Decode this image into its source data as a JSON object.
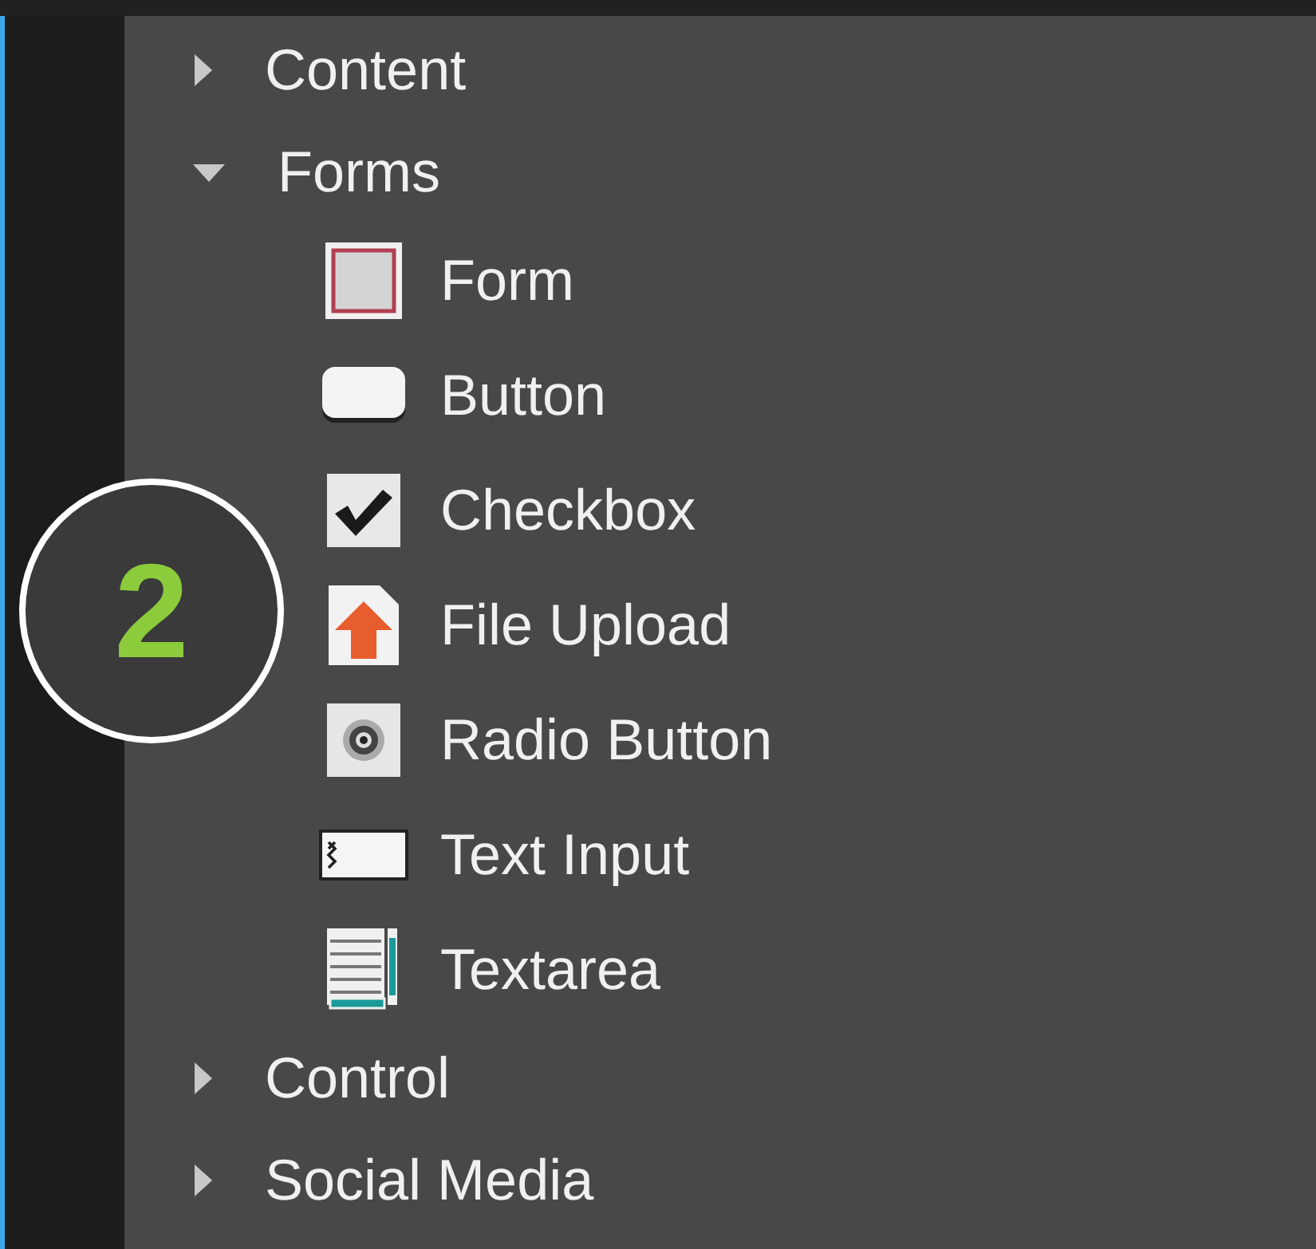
{
  "tree": [
    {
      "label": "Content",
      "expanded": false
    },
    {
      "label": "Forms",
      "expanded": true,
      "children": [
        {
          "label": "Form",
          "kind": "form"
        },
        {
          "label": "Button",
          "kind": "button"
        },
        {
          "label": "Checkbox",
          "kind": "checkbox"
        },
        {
          "label": "File Upload",
          "kind": "upload"
        },
        {
          "label": "Radio Button",
          "kind": "radio"
        },
        {
          "label": "Text Input",
          "kind": "textinput"
        },
        {
          "label": "Textarea",
          "kind": "textarea"
        }
      ]
    },
    {
      "label": "Control",
      "expanded": false
    },
    {
      "label": "Social Media",
      "expanded": false
    }
  ],
  "step_badge": "2"
}
